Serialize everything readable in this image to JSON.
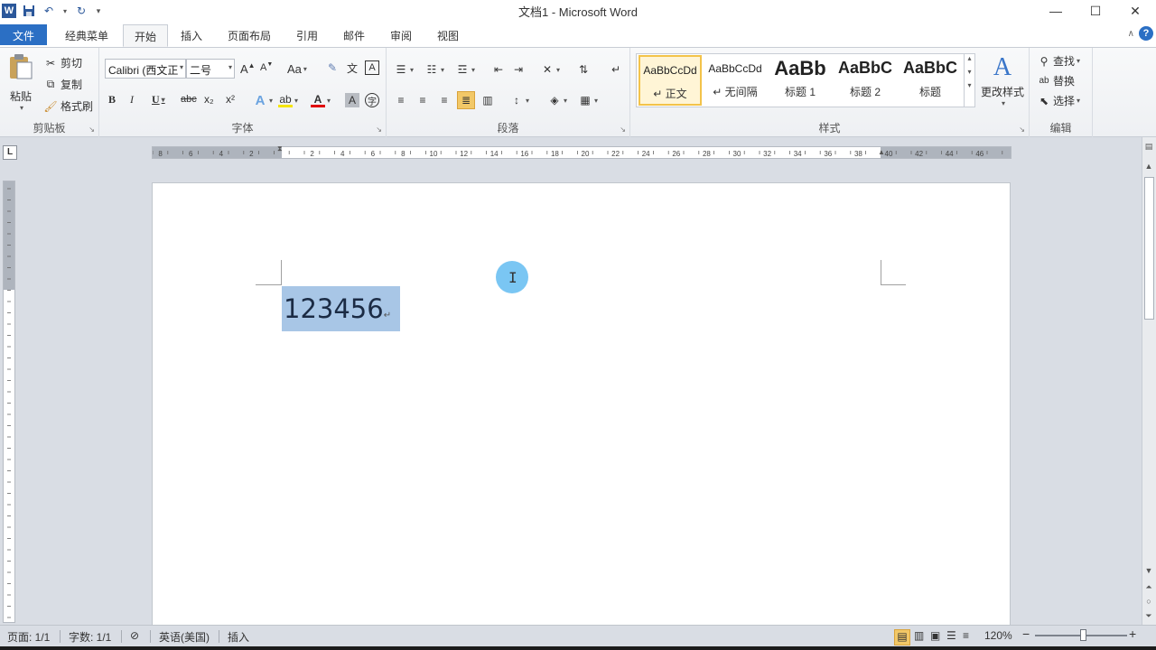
{
  "window": {
    "title": "文档1 - Microsoft Word"
  },
  "qat": {
    "app_letter": "W"
  },
  "tabs": [
    {
      "label": "文件"
    },
    {
      "label": "经典菜单"
    },
    {
      "label": "开始"
    },
    {
      "label": "插入"
    },
    {
      "label": "页面布局"
    },
    {
      "label": "引用"
    },
    {
      "label": "邮件"
    },
    {
      "label": "审阅"
    },
    {
      "label": "视图"
    }
  ],
  "active_tab": "开始",
  "clipboard": {
    "paste": "粘贴",
    "cut": "剪切",
    "copy": "复制",
    "format_painter": "格式刷",
    "label": "剪贴板"
  },
  "font": {
    "name": "Calibri (西文正",
    "size": "二号",
    "label": "字体",
    "bold": "B",
    "italic": "I",
    "underline": "U",
    "strike": "abc",
    "subscript": "x₂",
    "superscript": "x²",
    "grow": "A",
    "shrink": "A",
    "case": "Aa",
    "color_letter": "A"
  },
  "paragraph": {
    "label": "段落"
  },
  "styles": {
    "label": "样式",
    "items": [
      {
        "sample": "AaBbCcDd",
        "name": "↵ 正文"
      },
      {
        "sample": "AaBbCcDd",
        "name": "↵ 无间隔"
      },
      {
        "sample": "AaBb",
        "name": "标题 1"
      },
      {
        "sample": "AaBbC",
        "name": "标题 2"
      },
      {
        "sample": "AaBbC",
        "name": "标题"
      }
    ],
    "change_styles": "更改样式"
  },
  "editing": {
    "label": "编辑",
    "find": "查找",
    "replace": "替换",
    "select": "选择"
  },
  "ruler": {
    "tab_selector": "L",
    "ticks": [
      "8",
      "6",
      "4",
      "2",
      "2",
      "4",
      "6",
      "8",
      "10",
      "12",
      "14",
      "16",
      "18",
      "20",
      "22",
      "24",
      "26",
      "28",
      "30",
      "32",
      "34",
      "36",
      "38",
      "40",
      "42",
      "44",
      "46",
      "48"
    ]
  },
  "document": {
    "text": "123456",
    "para_mark": "↵"
  },
  "statusbar": {
    "page": "页面: 1/1",
    "words": "字数: 1/1",
    "language": "英语(美国)",
    "mode": "插入",
    "zoom": "120%",
    "zoom_minus": "−",
    "zoom_plus": "+"
  },
  "colors": {
    "file_tab": "#2b6fc4",
    "selection": "#a8c6e6",
    "cursor_highlight": "#6cc0f2",
    "ribbon_bg": "#f5f6f7",
    "workspace": "#d9dde4"
  }
}
